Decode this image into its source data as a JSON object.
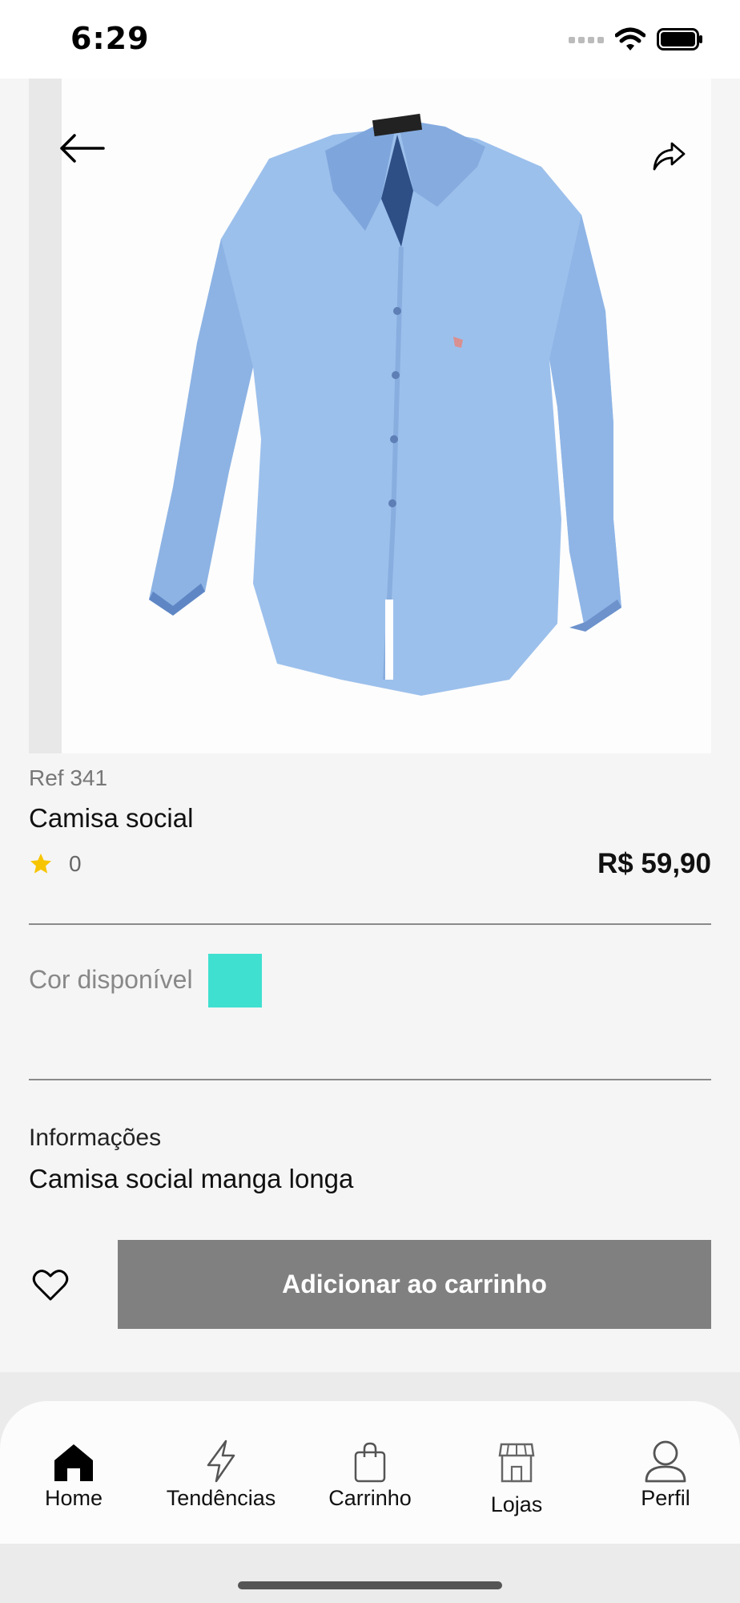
{
  "status_bar": {
    "time": "6:29"
  },
  "product": {
    "ref": "Ref 341",
    "name": "Camisa social",
    "rating_count": "0",
    "price": "R$ 59,90",
    "shirt_color": "#9cc0ec"
  },
  "colors": {
    "label": "Cor disponível",
    "swatch": "#40e0d0"
  },
  "info": {
    "title": "Informações",
    "description": "Camisa social manga longa"
  },
  "actions": {
    "add_to_cart": "Adicionar ao carrinho"
  },
  "tab_bar": {
    "items": [
      {
        "label": "Home",
        "icon": "home-icon",
        "active": true
      },
      {
        "label": "Tendências",
        "icon": "lightning-icon",
        "active": false
      },
      {
        "label": "Carrinho",
        "icon": "shopping-bag-icon",
        "active": false
      },
      {
        "label": "Lojas",
        "icon": "store-icon",
        "active": false
      },
      {
        "label": "Perfil",
        "icon": "user-icon",
        "active": false
      }
    ]
  },
  "theme": {
    "button_gray": "#808080",
    "star_color": "#f7c500"
  }
}
